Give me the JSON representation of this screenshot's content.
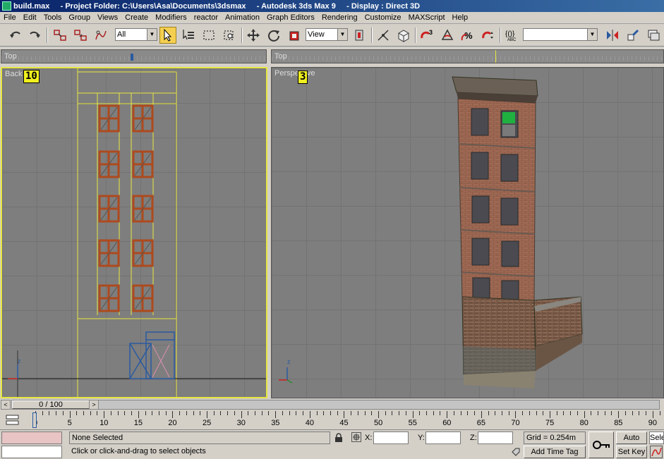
{
  "titlebar": {
    "text": "build.max     - Project Folder: C:\\Users\\Asa\\Documents\\3dsmax     - Autodesk 3ds Max 9     - Display : Direct 3D"
  },
  "menu": [
    "File",
    "Edit",
    "Tools",
    "Group",
    "Views",
    "Create",
    "Modifiers",
    "reactor",
    "Animation",
    "Graph Editors",
    "Rendering",
    "Customize",
    "MAXScript",
    "Help"
  ],
  "toolbar": {
    "selection_filter": "All",
    "reference_coord": "View",
    "named_selection": ""
  },
  "viewports": {
    "top_strip_left_label": "Top",
    "top_strip_right_label": "Top",
    "back_label": "Back",
    "back_badge": "10",
    "persp_label": "Perspective",
    "persp_badge": "3",
    "axis_z": "z"
  },
  "timeslider": {
    "position": "0 / 100",
    "left_arrow": "<",
    "right_arrow": ">"
  },
  "trackbar": {
    "ticks": [
      0,
      5,
      10,
      15,
      20,
      25,
      30,
      35,
      40,
      45,
      50,
      55,
      60,
      65,
      70,
      75,
      80,
      85,
      90
    ]
  },
  "status": {
    "selection": "None Selected",
    "prompt": "Click or click-and-drag to select objects",
    "x_label": "X:",
    "y_label": "Y:",
    "z_label": "Z:",
    "grid": "Grid = 0.254m",
    "add_time_tag": "Add Time Tag",
    "auto_key": "Auto Key",
    "set_key": "Set Key",
    "selected": "Sele"
  },
  "colors": {
    "accent_yellow": "#e6e640",
    "window_frame": "#ad4a1e",
    "viewport_bg": "#7e7e7e"
  }
}
